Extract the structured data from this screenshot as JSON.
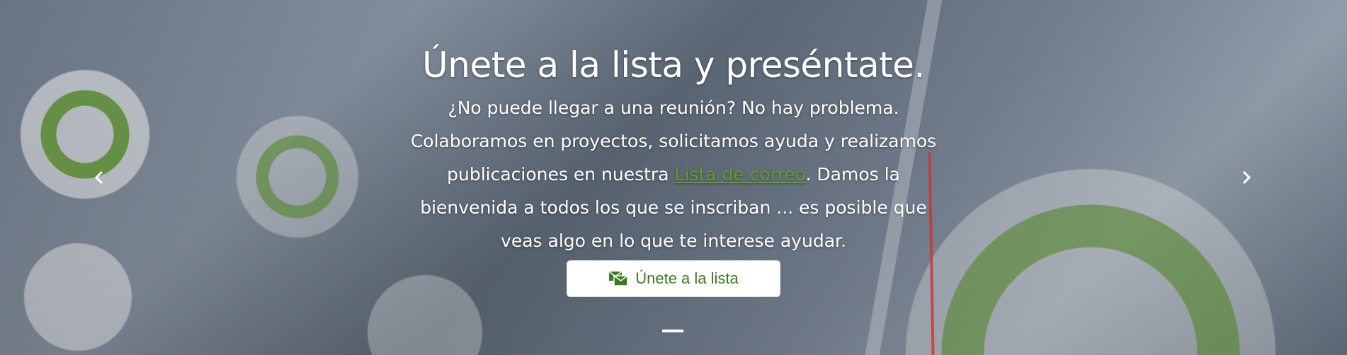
{
  "hero": {
    "title": "Únete a la lista y preséntate.",
    "body_before_link": "¿No puede llegar a una reunión? No hay problema. Colaboramos en proyectos, solicitamos ayuda y realizamos publicaciones en nuestra ",
    "link_text": "Lista de correo",
    "body_after_link": ". Damos la bienvenida a todos los que se inscriban ... es posible que veas algo en lo que te interese ayudar.",
    "button_label": "Únete a la lista",
    "button_icon": "mail-stack-icon",
    "link_color": "#5e9e2a",
    "button_text_color": "#3c7a1e"
  },
  "carousel": {
    "prev_icon": "chevron-left-icon",
    "next_icon": "chevron-right-icon",
    "indicator_count": 1,
    "active_slide": 1
  }
}
